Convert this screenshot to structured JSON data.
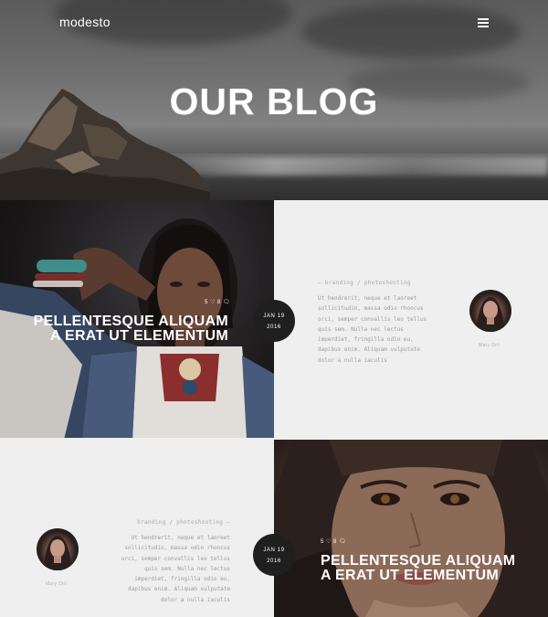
{
  "site": {
    "logo": "modesto",
    "menu_icon": "hamburger-menu-icon"
  },
  "hero": {
    "title": "OUR BLOG"
  },
  "posts": [
    {
      "title_line1": "PELLENTESQUE ALIQUAM",
      "title_line2": "A ERAT UT ELEMENTUM",
      "meta": "5 ♡ 8 🗨",
      "date_line1": "JAN 19",
      "date_line2": "2016",
      "category": "—  branding / photoshooting",
      "excerpt": "Ut hendrerit, neque et laoreet sollicitudin, massa odio rhoncus orci, semper convallis leo tellus quis sem. Nulla nec lectus imperdiet, fringilla odio eu, dapibus enim. Aliquam vulputate dolor a nulla iaculis",
      "author": "Mary Oril"
    },
    {
      "title_line1": "PELLENTESQUE ALIQUAM",
      "title_line2": "A ERAT UT ELEMENTUM",
      "meta": "5 ♡ 8 🗨",
      "date_line1": "JAN 19",
      "date_line2": "2016",
      "category": "branding / photoshooting  —",
      "excerpt": "Ut hendrerit, neque et laoreet sollicitudin, massa odio rhoncus orci, semper convallis leo tellus quis sem. Nulla nec lectus imperdiet, fringilla odio eu, dapibus enim. Aliquam vulputate dolor a nulla iaculis",
      "author": "Mary Oril"
    }
  ]
}
